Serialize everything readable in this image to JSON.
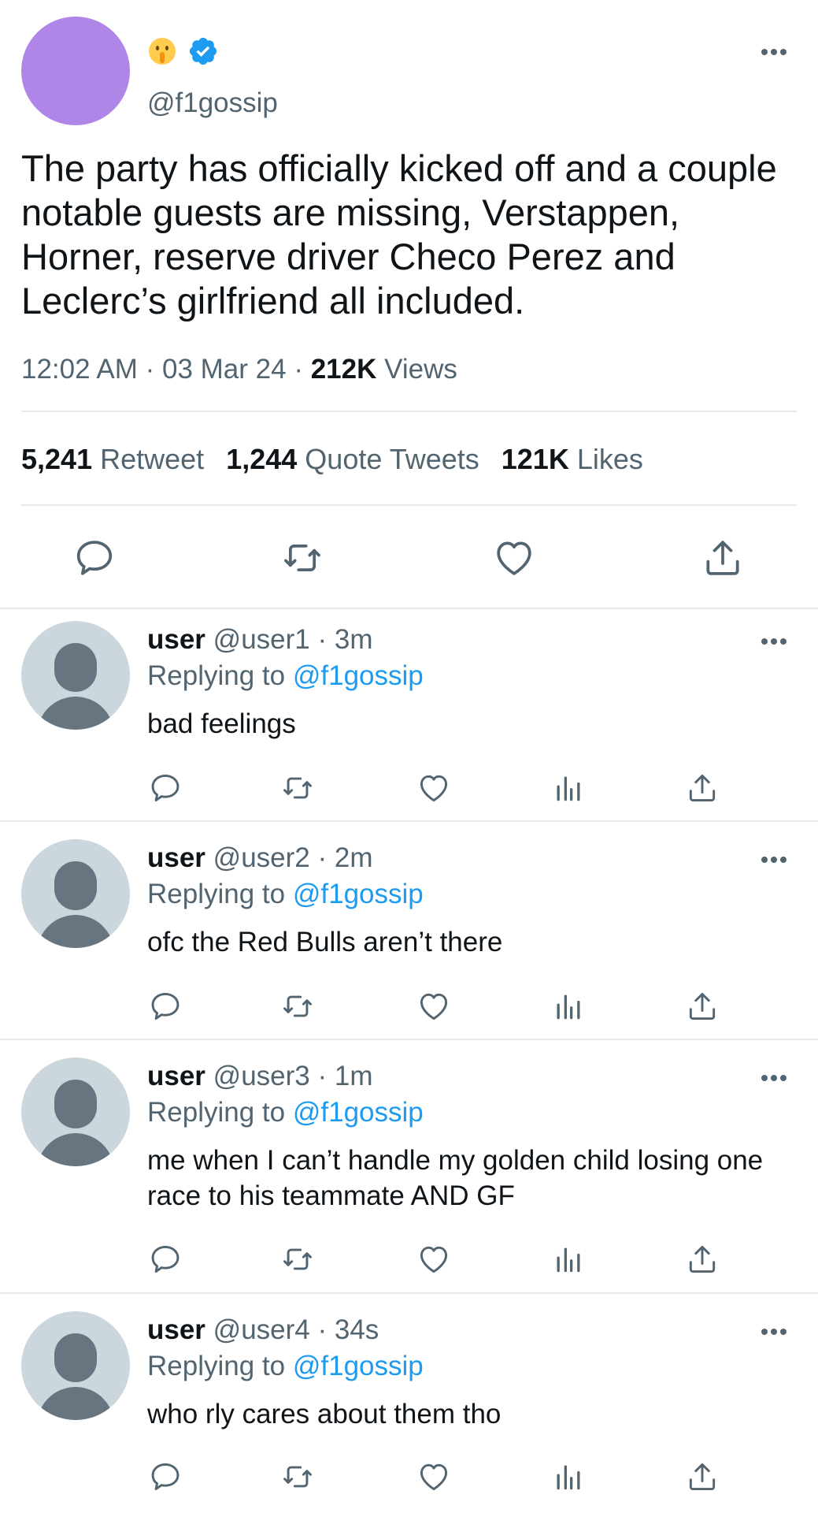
{
  "main_tweet": {
    "handle": "@f1gossip",
    "text": "The party has officially kicked off and a couple notable guests are missing, Verstappen, Horner, reserve driver Checo Perez and Leclerc’s girlfriend all included.",
    "time": "12:02 AM",
    "date": "03 Mar 24",
    "sep": " · ",
    "views_count": "212K",
    "views_label": "Views",
    "retweets_count": "5,241",
    "retweets_label": "Retweet",
    "quotes_count": "1,244",
    "quotes_label": "Quote Tweets",
    "likes_count": "121K",
    "likes_label": "Likes",
    "avatar_color": "#b085e8"
  },
  "replies": [
    {
      "name": "user",
      "handle": "@user1",
      "time": "3m",
      "replying_label": "Replying to",
      "replying_to": "@f1gossip",
      "text": "bad feelings"
    },
    {
      "name": "user",
      "handle": "@user2",
      "time": "2m",
      "replying_label": "Replying to",
      "replying_to": "@f1gossip",
      "text": "ofc the Red Bulls aren’t there"
    },
    {
      "name": "user",
      "handle": "@user3",
      "time": "1m",
      "replying_label": "Replying to",
      "replying_to": "@f1gossip",
      "text": "me when I can’t handle my golden child losing one race to his teammate AND GF"
    },
    {
      "name": "user",
      "handle": "@user4",
      "time": "34s",
      "replying_label": "Replying to",
      "replying_to": "@f1gossip",
      "text": "who rly cares about them tho"
    }
  ],
  "icons": {
    "emoji": "shushing-face-emoji-icon",
    "verified": "verified-badge-icon",
    "more": "more-options-icon",
    "reply": "reply-icon",
    "retweet": "retweet-icon",
    "like": "like-icon",
    "analytics": "analytics-icon",
    "share": "share-icon"
  },
  "colors": {
    "accent": "#1d9bf0",
    "secondary_text": "#536471",
    "divider": "#e7e9ea",
    "default_avatar": "#ccd6dd"
  }
}
